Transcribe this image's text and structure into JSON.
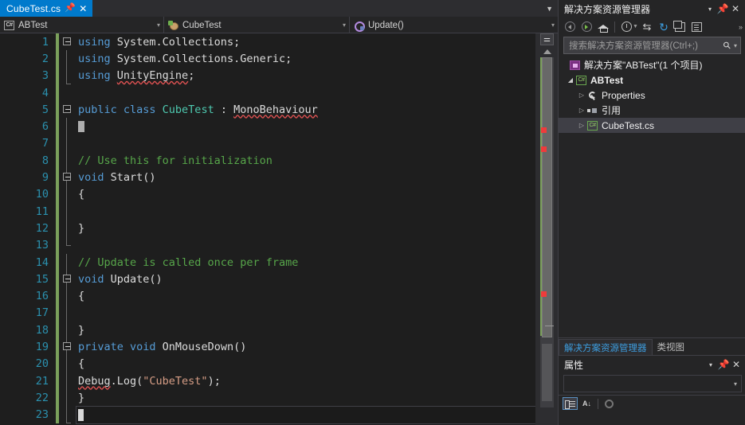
{
  "editor": {
    "tab": {
      "label": "CubeTest.cs",
      "pin_icon": "pin-icon",
      "close_icon": "close-icon",
      "list_chevron_icon": "chevron-down-icon"
    },
    "navbar": [
      {
        "icon": "csharp-project-icon",
        "text": "ABTest",
        "chevron": "▾"
      },
      {
        "icon": "class-icon",
        "text": "CubeTest",
        "chevron": "▾"
      },
      {
        "icon": "method-icon",
        "text": "Update()",
        "chevron": "▾"
      }
    ],
    "lines": [
      {
        "n": "1",
        "changed": true
      },
      {
        "n": "2",
        "changed": true
      },
      {
        "n": "3",
        "changed": true
      },
      {
        "n": "4",
        "changed": true
      },
      {
        "n": "5",
        "changed": true
      },
      {
        "n": "6",
        "changed": true
      },
      {
        "n": "7",
        "changed": true
      },
      {
        "n": "8",
        "changed": true
      },
      {
        "n": "9",
        "changed": true
      },
      {
        "n": "10",
        "changed": true
      },
      {
        "n": "11",
        "changed": true
      },
      {
        "n": "12",
        "changed": true
      },
      {
        "n": "13",
        "changed": true
      },
      {
        "n": "14",
        "changed": true
      },
      {
        "n": "15",
        "changed": true
      },
      {
        "n": "16",
        "changed": true
      },
      {
        "n": "17",
        "changed": true
      },
      {
        "n": "18",
        "changed": true
      },
      {
        "n": "19",
        "changed": true
      },
      {
        "n": "20",
        "changed": true
      },
      {
        "n": "21",
        "changed": true
      },
      {
        "n": "22",
        "changed": true
      },
      {
        "n": "23",
        "changed": true
      }
    ],
    "code": {
      "l1_kw": "using",
      "l1_ns": " System.Collections;",
      "l2_kw": "using",
      "l2_ns": " System.Collections.Generic;",
      "l3_kw": "using",
      "l3_ns_a": " ",
      "l3_ns_b": "UnityEngine",
      "l3_ns_c": ";",
      "l5_kw": "public class ",
      "l5_type": "CubeTest",
      "l5_sep": " : ",
      "l5_base": "MonoBehaviour",
      "l8_comment": "// Use this for initialization",
      "l9_kw": "void ",
      "l9_name": "Start",
      "l9_parens": "()",
      "l10_brace": "{",
      "l12_brace": "}",
      "l14_comment": "// Update is called once per frame",
      "l15_kw": "void ",
      "l15_name": "Update",
      "l15_parens": "()",
      "l16_brace": "{",
      "l18_brace": "}",
      "l19_kw": "private void ",
      "l19_name": "OnMouseDown",
      "l19_parens": "()",
      "l20_brace": "{",
      "l21_obj": "Debug",
      "l21_dot": ".Log(",
      "l21_str": "\"CubeTest\"",
      "l21_tail": ");",
      "l22_brace": "}"
    },
    "scrollbar": {
      "split_icon": "split-editor-icon",
      "up_arrow_icon": "scroll-up-icon",
      "error_marker_icon": "error-marker-icon"
    }
  },
  "solution_explorer": {
    "title": "解决方案资源管理器",
    "header_buttons": [
      {
        "name": "window-menu-chevron-icon",
        "glyph": "▾"
      },
      {
        "name": "pin-icon",
        "glyph": "✕"
      },
      {
        "name": "close-icon",
        "glyph": "✕"
      }
    ],
    "toolbar": [
      {
        "name": "back-button",
        "kind": "arrow-l"
      },
      {
        "name": "forward-button",
        "kind": "arrow-r"
      },
      {
        "name": "home-button",
        "kind": "home"
      },
      {
        "name": "pending-changes-button",
        "kind": "clock"
      },
      {
        "name": "sync-with-active-document-button",
        "kind": "sync",
        "glyph": "⇆"
      },
      {
        "name": "refresh-button",
        "kind": "refresh",
        "glyph": "↻"
      },
      {
        "name": "collapse-all-button",
        "kind": "collapse"
      },
      {
        "name": "show-all-files-button",
        "kind": "props"
      }
    ],
    "overflow_glyph": "»",
    "search": {
      "placeholder": "搜索解决方案资源管理器(Ctrl+;)",
      "magnifier_glyph": "⚲",
      "chevron_glyph": "▾"
    },
    "tree": [
      {
        "level": 0,
        "expander": "",
        "icon": "solution-icon",
        "label": "解决方案\"ABTest\"(1 个项目)",
        "bold": false,
        "selected": false
      },
      {
        "level": 1,
        "expander": "◢",
        "icon": "csharp-project-icon",
        "label": "ABTest",
        "bold": true,
        "selected": false
      },
      {
        "level": 2,
        "expander": "▷",
        "icon": "wrench-icon",
        "label": "Properties",
        "bold": false,
        "selected": false
      },
      {
        "level": 2,
        "expander": "▷",
        "icon": "references-icon",
        "label": "引用",
        "bold": false,
        "selected": false
      },
      {
        "level": 2,
        "expander": "▷",
        "icon": "csharp-file-icon",
        "label": "CubeTest.cs",
        "bold": false,
        "selected": true
      }
    ],
    "bottom_tabs": [
      {
        "label": "解决方案资源管理器",
        "active": true
      },
      {
        "label": "类视图",
        "active": false
      }
    ]
  },
  "properties_window": {
    "title": "属性",
    "header_buttons": [
      {
        "name": "window-menu-chevron-icon",
        "glyph": "▾"
      },
      {
        "name": "pin-icon",
        "glyph": "✕"
      },
      {
        "name": "close-icon",
        "glyph": "✕"
      }
    ],
    "object_combo_chevron": "▾",
    "toolbar": [
      {
        "name": "categorized-button",
        "kind": "cat",
        "pressed": true
      },
      {
        "name": "alphabetical-button",
        "kind": "az",
        "glyph": "A↓",
        "pressed": false
      },
      {
        "name": "properties-view-button",
        "kind": "wheel",
        "pressed": false
      }
    ]
  },
  "colors": {
    "accent": "#007acc",
    "editor_bg": "#1e1e1e",
    "chrome_bg": "#252526",
    "line_number": "#2b91af",
    "keyword": "#569cd6",
    "type": "#4ec9b0",
    "comment": "#57a64a",
    "string": "#d69d85",
    "change_bar": "#7ba05b",
    "error": "#ef3b3b"
  }
}
